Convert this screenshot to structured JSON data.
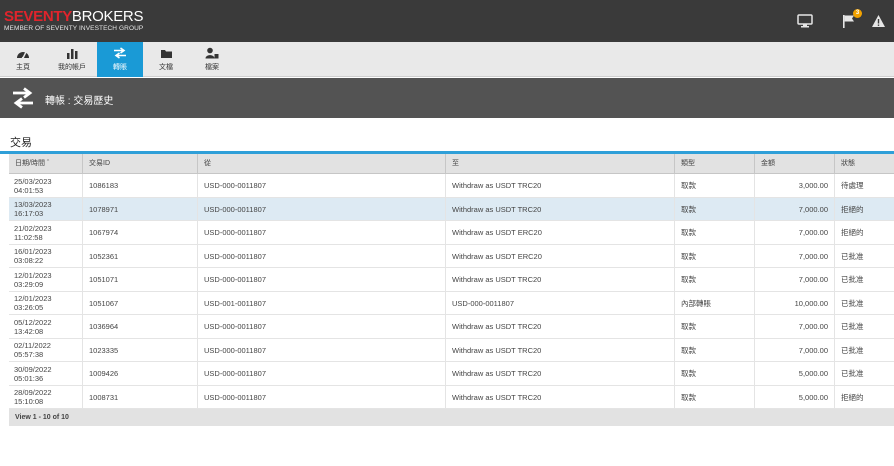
{
  "brand": {
    "name_red": "SEVENTY",
    "name_white": "BROKERS",
    "tagline": "MEMBER OF SEVENTY INVESTECH GROUP"
  },
  "topbar": {
    "icons": [
      "monitor-icon",
      "flag-icon",
      "warning-icon"
    ],
    "notification_count": "3"
  },
  "nav": {
    "items": [
      {
        "label": "主頁",
        "icon": "dashboard-icon"
      },
      {
        "label": "我的帳戶",
        "icon": "bar-chart-icon"
      },
      {
        "label": "轉賬",
        "icon": "transfer-icon",
        "active": true
      },
      {
        "label": "文檔",
        "icon": "folder-icon"
      },
      {
        "label": "檔案",
        "icon": "profile-icon"
      }
    ]
  },
  "page": {
    "title": "轉帳 : 交易歷史"
  },
  "section": {
    "title": "交易"
  },
  "table": {
    "headers": [
      "日期/時間 ˆ",
      "交易ID",
      "從",
      "至",
      "類型",
      "金額",
      "狀態"
    ],
    "rows": [
      {
        "date": "25/03/2023",
        "time": "04:01:53",
        "id": "1086183",
        "from": "USD-000-0011807",
        "to": "Withdraw as USDT TRC20",
        "type": "取款",
        "amount": "3,000.00",
        "status": "待處理"
      },
      {
        "date": "13/03/2023",
        "time": "16:17:03",
        "id": "1078971",
        "from": "USD-000-0011807",
        "to": "Withdraw as USDT TRC20",
        "type": "取款",
        "amount": "7,000.00",
        "status": "拒絕的"
      },
      {
        "date": "21/02/2023",
        "time": "11:02:58",
        "id": "1067974",
        "from": "USD-000-0011807",
        "to": "Withdraw as USDT ERC20",
        "type": "取款",
        "amount": "7,000.00",
        "status": "拒絕的"
      },
      {
        "date": "16/01/2023",
        "time": "03:08:22",
        "id": "1052361",
        "from": "USD-000-0011807",
        "to": "Withdraw as USDT ERC20",
        "type": "取款",
        "amount": "7,000.00",
        "status": "已批准"
      },
      {
        "date": "12/01/2023",
        "time": "03:29:09",
        "id": "1051071",
        "from": "USD-000-0011807",
        "to": "Withdraw as USDT TRC20",
        "type": "取款",
        "amount": "7,000.00",
        "status": "已批准"
      },
      {
        "date": "12/01/2023",
        "time": "03:26:05",
        "id": "1051067",
        "from": "USD-001-0011807",
        "to": "USD-000-0011807",
        "type": "內部轉賬",
        "amount": "10,000.00",
        "status": "已批准"
      },
      {
        "date": "05/12/2022",
        "time": "13:42:08",
        "id": "1036964",
        "from": "USD-000-0011807",
        "to": "Withdraw as USDT TRC20",
        "type": "取款",
        "amount": "7,000.00",
        "status": "已批准"
      },
      {
        "date": "02/11/2022",
        "time": "05:57:38",
        "id": "1023335",
        "from": "USD-000-0011807",
        "to": "Withdraw as USDT TRC20",
        "type": "取款",
        "amount": "7,000.00",
        "status": "已批准"
      },
      {
        "date": "30/09/2022",
        "time": "05:01:36",
        "id": "1009426",
        "from": "USD-000-0011807",
        "to": "Withdraw as USDT TRC20",
        "type": "取款",
        "amount": "5,000.00",
        "status": "已批准"
      },
      {
        "date": "28/09/2022",
        "time": "15:10:08",
        "id": "1008731",
        "from": "USD-000-0011807",
        "to": "Withdraw as USDT TRC20",
        "type": "取款",
        "amount": "5,000.00",
        "status": "拒絕的"
      }
    ],
    "footer": "View 1 - 10 of 10"
  },
  "colors": {
    "topbar": "#3a3a3a",
    "accent": "#1a9ad6",
    "header_band": "#535353",
    "selected_row": "#ddeaf3",
    "brand_red": "#e0242c",
    "badge": "#f2a200"
  }
}
